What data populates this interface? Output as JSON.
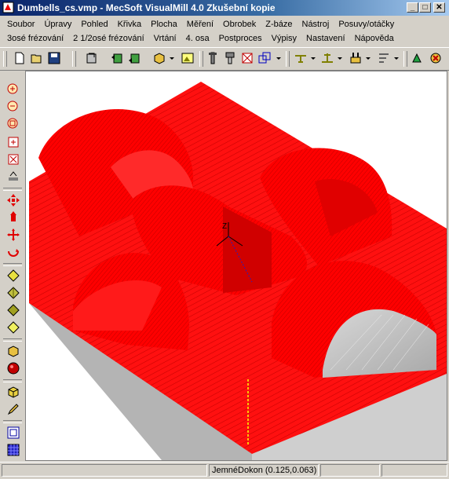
{
  "window": {
    "title": "Dumbells_cs.vmp - MecSoft  VisualMill 4.0 Zkušební kopie",
    "min_label": "_",
    "max_label": "□",
    "close_label": "✕"
  },
  "menu": {
    "row1": [
      "Soubor",
      "Úpravy",
      "Pohled",
      "Křivka",
      "Plocha",
      "Měření",
      "Obrobek",
      "Z-báze",
      "Nástroj",
      "Posuvy/otáčky"
    ],
    "row2": [
      "3osé frézování",
      "2 1/2osé frézování",
      "Vrtání",
      "4. osa",
      "Postproces",
      "Výpisy",
      "Nastavení",
      "Nápověda"
    ]
  },
  "toolbar": {
    "icons": [
      "new-file-icon",
      "open-folder-icon",
      "save-icon",
      "refresh-icon",
      "view-front-icon",
      "view-back-icon",
      "stock-box-icon",
      "picture-icon",
      "tool-icon",
      "tool-holder-icon",
      "mirror-icon",
      "transform-icon",
      "toolpath-icon",
      "level-icon",
      "drill-icon",
      "feed-icon",
      "simulate-icon",
      "stop-simulate-icon"
    ]
  },
  "left_toolbar": {
    "icons": [
      "zoom-in-icon",
      "zoom-out-icon",
      "zoom-fit-icon",
      "zoom-window-icon",
      "zoom-extents-icon",
      "section-icon",
      "pan-icon",
      "dynamic-rotate-icon",
      "move-icon",
      "rotate-z-icon",
      "view-top-icon",
      "view-iso-icon",
      "view-side-icon",
      "view-front-shade-icon",
      "shade-icon",
      "sphere-icon",
      "part-icon",
      "edit-icon",
      "window-icon",
      "grid-icon"
    ]
  },
  "viewport": {
    "axis_label": "Z",
    "colors": {
      "toolpath": "#ff0000",
      "stock_side": "#b4b4b4",
      "stock_top": "#cccccc"
    }
  },
  "status": {
    "coords": "JemnéDokon (0.125,0.063)"
  }
}
